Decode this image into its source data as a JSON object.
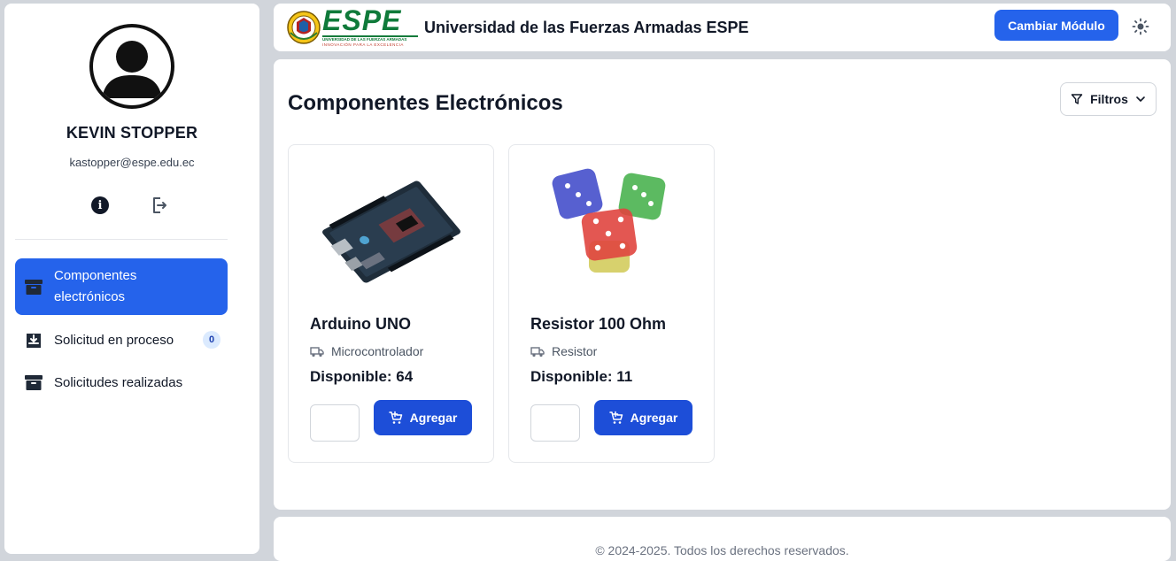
{
  "user": {
    "name": "KEVIN STOPPER",
    "email": "kastopper@espe.edu.ec"
  },
  "sidebar": {
    "items": [
      {
        "label": "Componentes electrónicos",
        "icon": "archive-icon",
        "active": true
      },
      {
        "label": "Solicitud en proceso",
        "icon": "download-tray-icon",
        "badge": "0"
      },
      {
        "label": "Solicitudes realizadas",
        "icon": "archive-icon"
      }
    ]
  },
  "header": {
    "logo_text": "ESPE",
    "logo_line1": "UNIVERSIDAD DE LAS FUERZAS ARMADAS",
    "logo_line2": "INNOVACIÓN PARA LA EXCELENCIA",
    "title": "Universidad de las Fuerzas Armadas ESPE",
    "module_button": "Cambiar Módulo",
    "theme_icon": "sun-icon"
  },
  "main": {
    "title": "Componentes Electrónicos",
    "filter_label": "Filtros",
    "products": [
      {
        "name": "Arduino UNO",
        "category": "Microcontrolador",
        "stock": "Disponible: 64",
        "qty": "",
        "add_label": "Agregar",
        "image": "arduino-board-image"
      },
      {
        "name": "Resistor 100 Ohm",
        "category": "Resistor",
        "stock": "Disponible: 11",
        "qty": "",
        "add_label": "Agregar",
        "image": "dice-image"
      }
    ]
  },
  "footer": {
    "text": "© 2024-2025. Todos los derechos reservados."
  },
  "colors": {
    "primary": "#2563eb",
    "primary_dark": "#1d4ed8",
    "brand_green": "#0f7a3a",
    "background": "#d1d5db"
  }
}
